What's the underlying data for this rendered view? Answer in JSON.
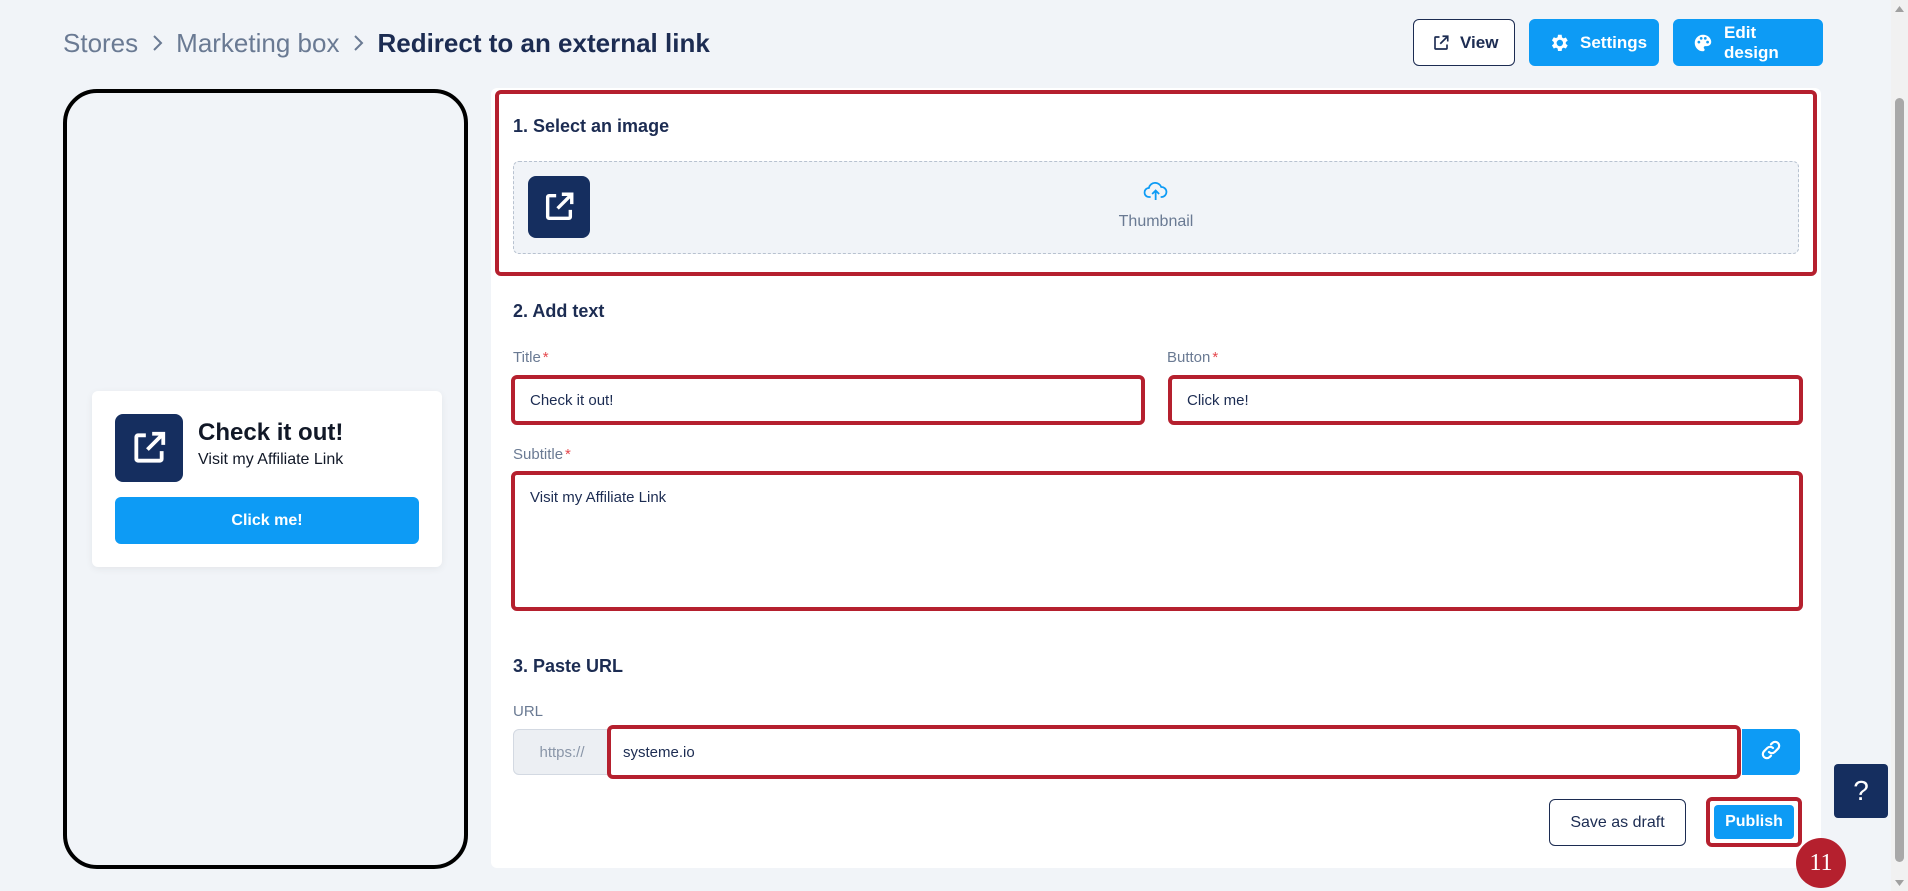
{
  "breadcrumb": {
    "items": [
      "Stores",
      "Marketing box"
    ],
    "current": "Redirect to an external link"
  },
  "toolbar": {
    "view_label": "View",
    "settings_label": "Settings",
    "edit_design_label": "Edit design"
  },
  "preview": {
    "title": "Check it out!",
    "subtitle": "Visit my Affiliate Link",
    "button": "Click me!"
  },
  "form": {
    "section_image": "1. Select an image",
    "thumbnail_label": "Thumbnail",
    "section_text": "2. Add text",
    "title_label": "Title",
    "title_value": "Check it out!",
    "button_label": "Button",
    "button_value": "Click me!",
    "subtitle_label": "Subtitle",
    "subtitle_value": "Visit my Affiliate Link",
    "required_marker": "*",
    "section_url": "3. Paste URL",
    "url_label": "URL",
    "url_prefix": "https://",
    "url_value": "systeme.io",
    "save_draft_label": "Save as draft",
    "publish_label": "Publish"
  },
  "step_badge": "11",
  "help_label": "?",
  "colors": {
    "primary": "#0d9bf5",
    "navy": "#152e5f",
    "highlight": "#b5202e",
    "background": "#f1f4f8"
  },
  "icons": [
    "chevron-right-icon",
    "external-link-icon",
    "gear-icon",
    "palette-icon",
    "cloud-upload-icon",
    "link-icon",
    "help-icon"
  ]
}
